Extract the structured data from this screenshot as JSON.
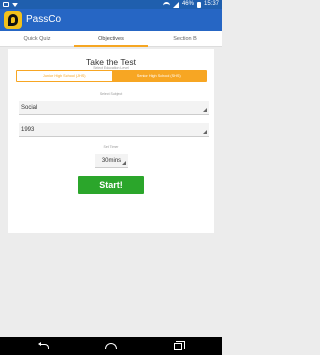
{
  "status": {
    "battery": "46%",
    "time": "15:37",
    "icons": [
      "image-icon",
      "download-icon",
      "wifi-icon",
      "signal-icon",
      "battery-icon"
    ]
  },
  "app": {
    "title": "PassCo"
  },
  "tabs": [
    {
      "label": "Quick Quiz"
    },
    {
      "label": "Objectives"
    },
    {
      "label": "Section B"
    }
  ],
  "main": {
    "heading": "Take the Test",
    "education_level": {
      "label": "Select Education Level",
      "options": [
        "Junior High School (JHS)",
        "Senior High School (SHS)"
      ],
      "selected": "Senior High School (SHS)"
    },
    "subject": {
      "label": "Select Subject",
      "value": "Social"
    },
    "year": {
      "value": "1993"
    },
    "timer": {
      "label": "Set Timer",
      "value": "30mins"
    },
    "start_label": "Start!"
  },
  "colors": {
    "app_bar": "#2666c4",
    "accent": "#f7a623",
    "start_button": "#2ba62b"
  }
}
